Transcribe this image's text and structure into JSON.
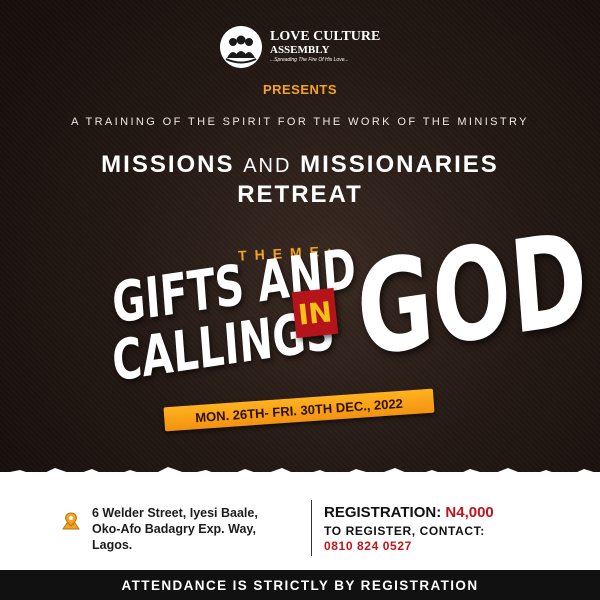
{
  "brand": {
    "name": "LOVE CULTURE",
    "sub": "ASSEMBLY",
    "tagline": "...Spreading The Fire Of His Love..."
  },
  "presents": "PRESENTS",
  "training": "A TRAINING OF THE SPIRIT FOR THE WORK OF THE MINISTRY",
  "headline": {
    "part1": "MISSIONS",
    "part2": "AND",
    "part3": "MISSIONARIES",
    "line2": "RETREAT"
  },
  "theme": {
    "label": "THEME:",
    "line1": "GIFTS AND",
    "line2": "CALLINGS",
    "in": "IN",
    "god": "GOD"
  },
  "date": "MON. 26TH- FRI. 30TH DEC., 2022",
  "address": {
    "line1": "6 Welder Street, Iyesi Baale,",
    "line2": "Oko-Afo Badagry Exp. Way,",
    "line3": "Lagos.",
    "icon": "location-pin-icon"
  },
  "registration": {
    "label": "REGISTRATION:",
    "price": "N4,000",
    "contact": "TO REGISTER, CONTACT:",
    "phone": "0810 824 0527"
  },
  "footer": "ATTENDANCE IS STRICTLY BY REGISTRATION",
  "colors": {
    "accent": "#f5a320",
    "red": "#c0141b",
    "background": "#1f1511"
  }
}
